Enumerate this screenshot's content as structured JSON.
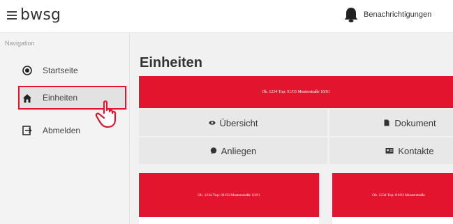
{
  "header": {
    "brand": "bwsg",
    "notifications_label": "Benachrichtigungen"
  },
  "sidebar": {
    "caption": "Navigation",
    "items": [
      {
        "label": "Startseite",
        "icon": "radio-circle-icon"
      },
      {
        "label": "Einheiten",
        "icon": "home-icon",
        "active": true
      },
      {
        "label": "Abmelden",
        "icon": "logout-icon"
      }
    ]
  },
  "main": {
    "title": "Einheiten",
    "unit_banner": "Ob. 1234 Top: 01/03 Musterstraße 10/01",
    "tabs": [
      {
        "label": "Übersicht",
        "icon": "eye-icon"
      },
      {
        "label": "Dokument",
        "icon": "document-icon"
      },
      {
        "label": "Anliegen",
        "icon": "chat-icon"
      },
      {
        "label": "Kontakte",
        "icon": "contact-card-icon"
      }
    ],
    "cards": [
      {
        "title": "Ob. 1234 Top: 01/03 Musterstraße 10/01"
      },
      {
        "title": "Ob. 1234 Top: 01/03 Musterstraße"
      }
    ]
  },
  "colors": {
    "accent_red": "#e3142d",
    "sidebar_bg": "#f3f3f3",
    "content_bg": "#f1f1f1"
  }
}
